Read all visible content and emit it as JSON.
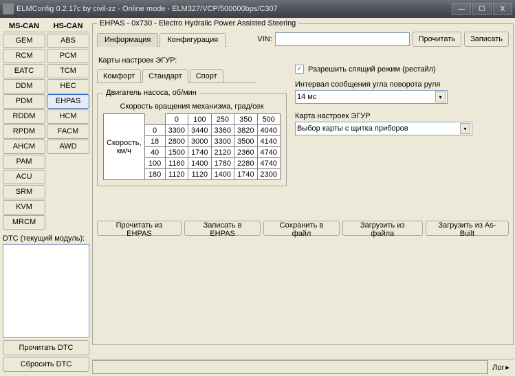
{
  "window": {
    "title": "ELMConfig 0.2.17c by civil-zz - Online mode - ELM327/VCP/500000bps/C307",
    "min": "—",
    "max": "☐",
    "close": "X"
  },
  "bus": {
    "ms_label": "MS-CAN",
    "hs_label": "HS-CAN",
    "ms_modules": [
      "GEM",
      "RCM",
      "EATC",
      "DDM",
      "PDM",
      "RDDM",
      "RPDM",
      "AHCM",
      "PAM",
      "ACU",
      "SRM",
      "KVM",
      "MRCM"
    ],
    "hs_modules": [
      "ABS",
      "PCM",
      "TCM",
      "HEC",
      "EHPAS",
      "HCM",
      "FACM",
      "AWD"
    ],
    "active_hs_index": 4
  },
  "dtc": {
    "label": "DTC (текущий модуль):",
    "read": "Прочитать DTC",
    "reset": "Сбросить DTC"
  },
  "module": {
    "title": "EHPAS - 0x730 - Electro Hydralic Power Assisted Steering",
    "tabs": {
      "info": "Информация",
      "config": "Конфигурация"
    },
    "vin_label": "VIN:",
    "vin_value": "",
    "read": "Прочитать",
    "write": "Записать"
  },
  "maps": {
    "label": "Карты настроек ЭГУР:",
    "subtabs": {
      "comfort": "Комфорт",
      "standard": "Стандарт",
      "sport": "Спорт"
    },
    "pump_title": "Двигатель насоса, об/мин",
    "rotation_label": "Скорость вращения механизма, град/сек",
    "speed_label": "Скорость, км/ч",
    "col_headers": [
      "0",
      "100",
      "250",
      "350",
      "500"
    ],
    "row_headers": [
      "0",
      "18",
      "40",
      "100",
      "180"
    ],
    "cells": [
      [
        "3300",
        "3440",
        "3360",
        "3820",
        "4040"
      ],
      [
        "2800",
        "3000",
        "3300",
        "3500",
        "4140"
      ],
      [
        "1500",
        "1740",
        "2120",
        "2360",
        "4740"
      ],
      [
        "1160",
        "1400",
        "1780",
        "2280",
        "4740"
      ],
      [
        "1120",
        "1120",
        "1400",
        "1740",
        "2300"
      ]
    ]
  },
  "right": {
    "sleep_label": "Разрешить спящий режим (рестайл)",
    "check": "✓",
    "interval_label": "Интервал сообщения угла поворота руля",
    "interval_value": "14 мс",
    "map_src_label": "Карта настроек ЭГУР",
    "map_src_value": "Выбор карты с щитка приборов"
  },
  "bottom": {
    "read_ehpas": "Прочитать из EHPAS",
    "write_ehpas": "Записать в EHPAS",
    "save_file": "Сохранить в файл",
    "load_file": "Загрузить из файла",
    "load_asbuilt": "Загрузить из As-Built"
  },
  "status": {
    "log": "Лог",
    "arrow": "▸"
  }
}
